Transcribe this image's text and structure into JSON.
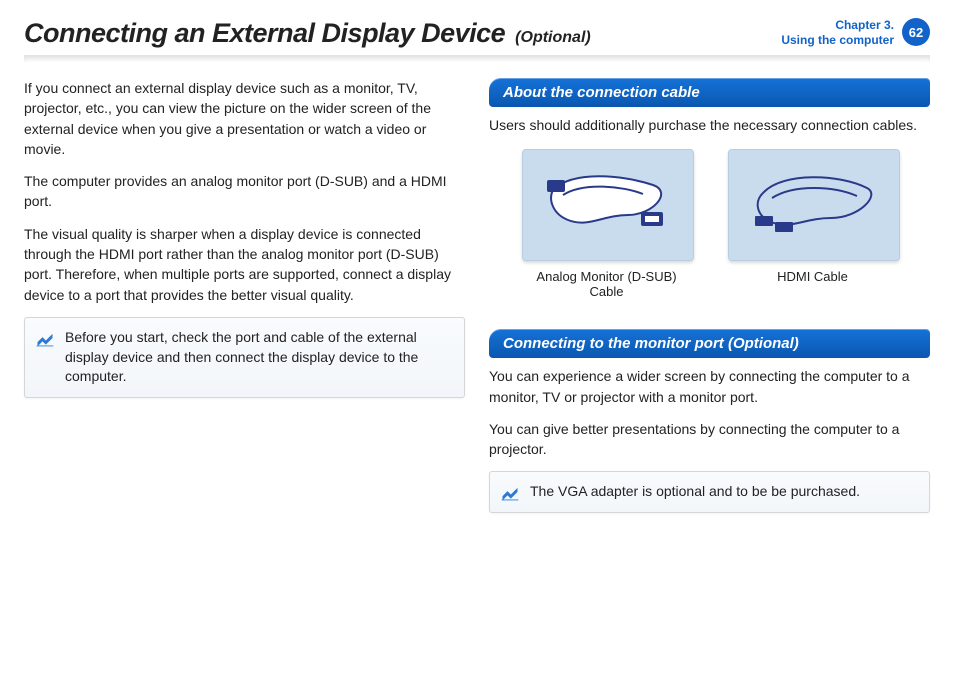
{
  "header": {
    "title": "Connecting an External Display Device",
    "subtitle": "(Optional)",
    "chapter_line1": "Chapter 3.",
    "chapter_line2": "Using the computer",
    "page_number": "62"
  },
  "left": {
    "p1": "If you connect an external display device such as a monitor, TV, projector, etc., you can view the picture on the wider screen of the external device when you give a presentation or watch a video or movie.",
    "p2": "The computer provides an analog monitor port (D-SUB) and a HDMI port.",
    "p3": "The visual quality is sharper when a display device is connected through the HDMI port rather than the analog monitor port (D-SUB) port. Therefore, when multiple ports are supported, connect a display device to a port that provides the better visual quality.",
    "note": "Before you start, check the port and cable of the external display device and then connect the display device to the computer."
  },
  "right": {
    "section1_title": "About the connection cable",
    "section1_p1": "Users should additionally purchase the necessary connection cables.",
    "cable1_label": "Analog Monitor (D-SUB) Cable",
    "cable2_label": "HDMI Cable",
    "section2_title": "Connecting to the monitor port (Optional)",
    "section2_p1": "You can experience a wider screen by connecting the computer to a monitor, TV or projector with a monitor port.",
    "section2_p2": "You can give better presentations by connecting the computer to a projector.",
    "note": "The VGA adapter is optional and to be be purchased."
  }
}
